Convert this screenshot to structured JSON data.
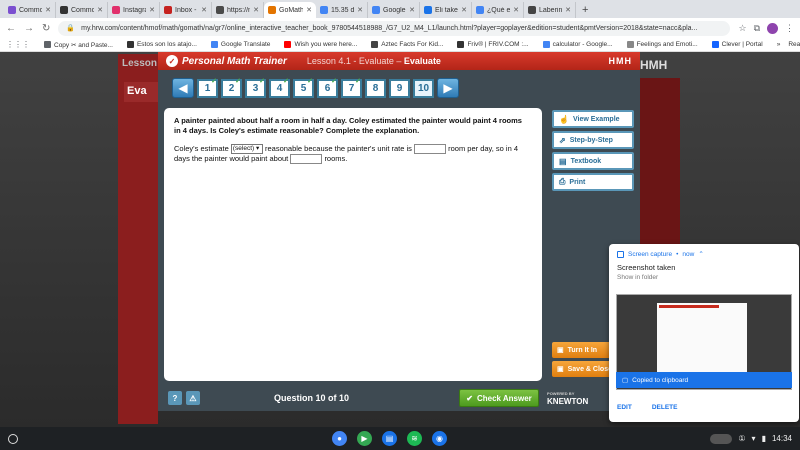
{
  "browser": {
    "tabs": [
      {
        "label": "Commons",
        "color": "#7b4fd0"
      },
      {
        "label": "Commons",
        "color": "#333333"
      },
      {
        "label": "Instagram",
        "color": "#e1306c"
      },
      {
        "label": "Inbox - n",
        "color": "#c5221f"
      },
      {
        "label": "https://m",
        "color": "#4a4a4a"
      },
      {
        "label": "GoMath!",
        "color": "#e37400"
      },
      {
        "label": "15.35 dia",
        "color": "#4285f4"
      },
      {
        "label": "Google T",
        "color": "#4285f4"
      },
      {
        "label": "Eli takes",
        "color": "#1a73e8"
      },
      {
        "label": "¿Qué es",
        "color": "#4285f4"
      },
      {
        "label": "Laberintu",
        "color": "#444444"
      }
    ],
    "url": "my.hrw.com/content/hmof/math/gomath/na/gr7/online_interactive_teacher_book_9780544518988_/G7_U2_M4_L1/launch.html?player=goplayer&edition=student&pmtVersion=2018&state=nacc&pla...",
    "bookmarks": [
      {
        "label": "Copy ✂ and Paste...",
        "color": "#5f6368"
      },
      {
        "label": "Estos son los atajo...",
        "color": "#333333"
      },
      {
        "label": "Google Translate",
        "color": "#4285f4"
      },
      {
        "label": "Wish you were here...",
        "color": "#ff0000"
      },
      {
        "label": "Aztec Facts For Kid...",
        "color": "#444444"
      },
      {
        "label": "Friv® | FRIV.COM :...",
        "color": "#333333"
      },
      {
        "label": "calculator - Google...",
        "color": "#4285f4"
      },
      {
        "label": "Feelings and Emoti...",
        "color": "#888888"
      },
      {
        "label": "Clever | Portal",
        "color": "#1464ff"
      }
    ],
    "reading_list": "Reading list"
  },
  "background": {
    "lesson": "Lesson",
    "ev": "Eva",
    "hmh": "HMH"
  },
  "pmt": {
    "title": "Personal Math Trainer",
    "lesson_prefix": "Lesson 4.1 - Evaluate – ",
    "lesson_bold": "Evaluate",
    "brand": "HMH",
    "questions": [
      "1",
      "2",
      "3",
      "4",
      "5",
      "6",
      "7",
      "8",
      "9",
      "10"
    ],
    "question_text": "A painter painted about half a room in half a day. Coley estimated the painter would paint 4 rooms in 4 days. Is Coley's estimate reasonable? Complete the explanation.",
    "answer": {
      "part1": "Coley's estimate",
      "select_value": "(select)",
      "part2": "reasonable because the painter's unit rate is",
      "part3": "room per day, so in 4 days the painter would paint about",
      "part4": "rooms."
    },
    "side_buttons": [
      "View Example",
      "Step-by-Step",
      "Textbook",
      "Print"
    ],
    "orange_buttons": [
      "Turn It In",
      "Save & Close"
    ],
    "footer": {
      "help": "?",
      "question_count": "Question 10 of 10",
      "check_answer": "Check Answer",
      "powered_by": "POWERED BY",
      "knewton": "KNEWTON"
    }
  },
  "notification": {
    "app": "Screen capture",
    "time": "now",
    "title": "Screenshot taken",
    "subtitle": "Show in folder",
    "copied": "Copied to clipboard",
    "edit": "EDIT",
    "delete": "DELETE"
  },
  "shelf": {
    "time": "14:34"
  }
}
